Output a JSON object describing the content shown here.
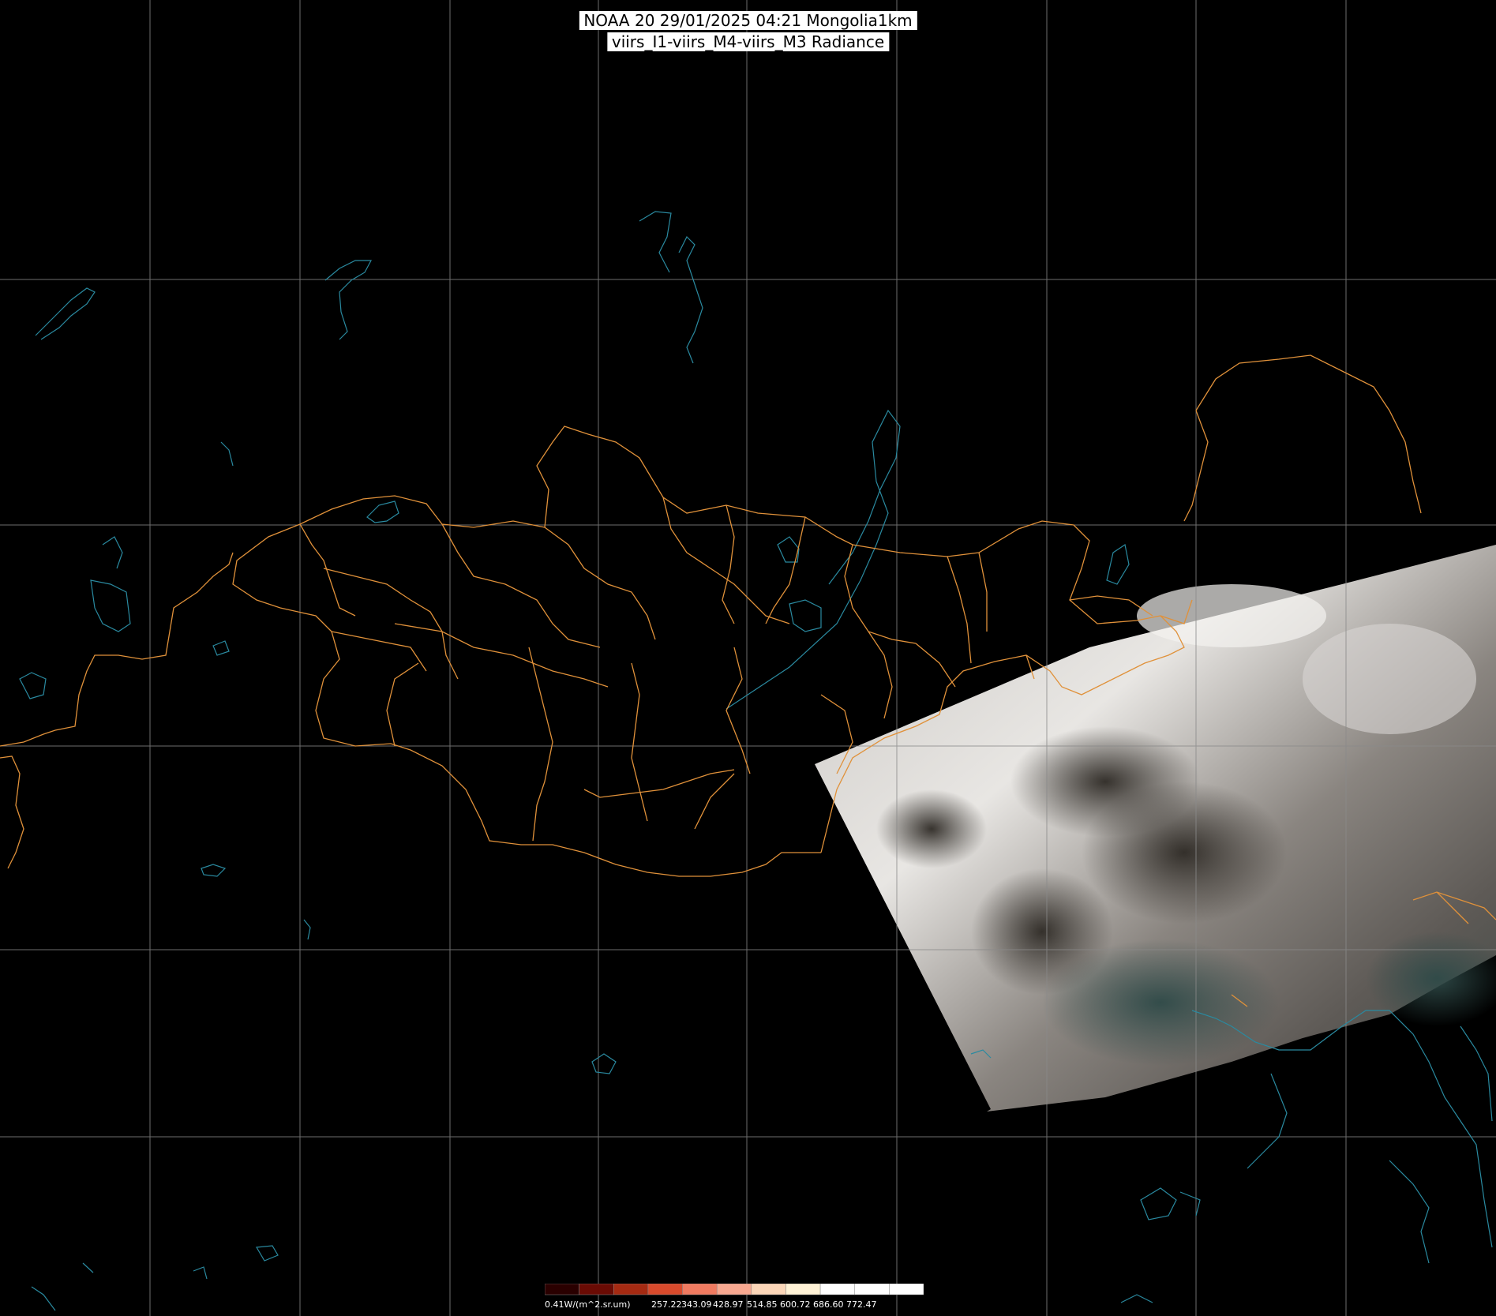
{
  "title": {
    "line1": "NOAA 20 29/01/2025 04:21 Mongolia1km",
    "line2": "viirs_I1-viirs_M4-viirs_M3 Radiance"
  },
  "colors": {
    "grid": "#8a8a8a",
    "border": "#e0913a",
    "coast": "#2a8aa0",
    "background": "#000000"
  },
  "colorbar": {
    "stops": [
      "#2a0000",
      "#6a0b04",
      "#a52a12",
      "#d84a2c",
      "#f07a60",
      "#f8a890",
      "#fbd6b8",
      "#fff2d6",
      "#ffffff",
      "#ffffff",
      "#ffffff"
    ],
    "labels": [
      "-0.41W/(m^2.sr.um)",
      "257.22",
      "343.09",
      "428.97",
      "514.85",
      "600.72",
      "686.60",
      "772.47"
    ]
  }
}
